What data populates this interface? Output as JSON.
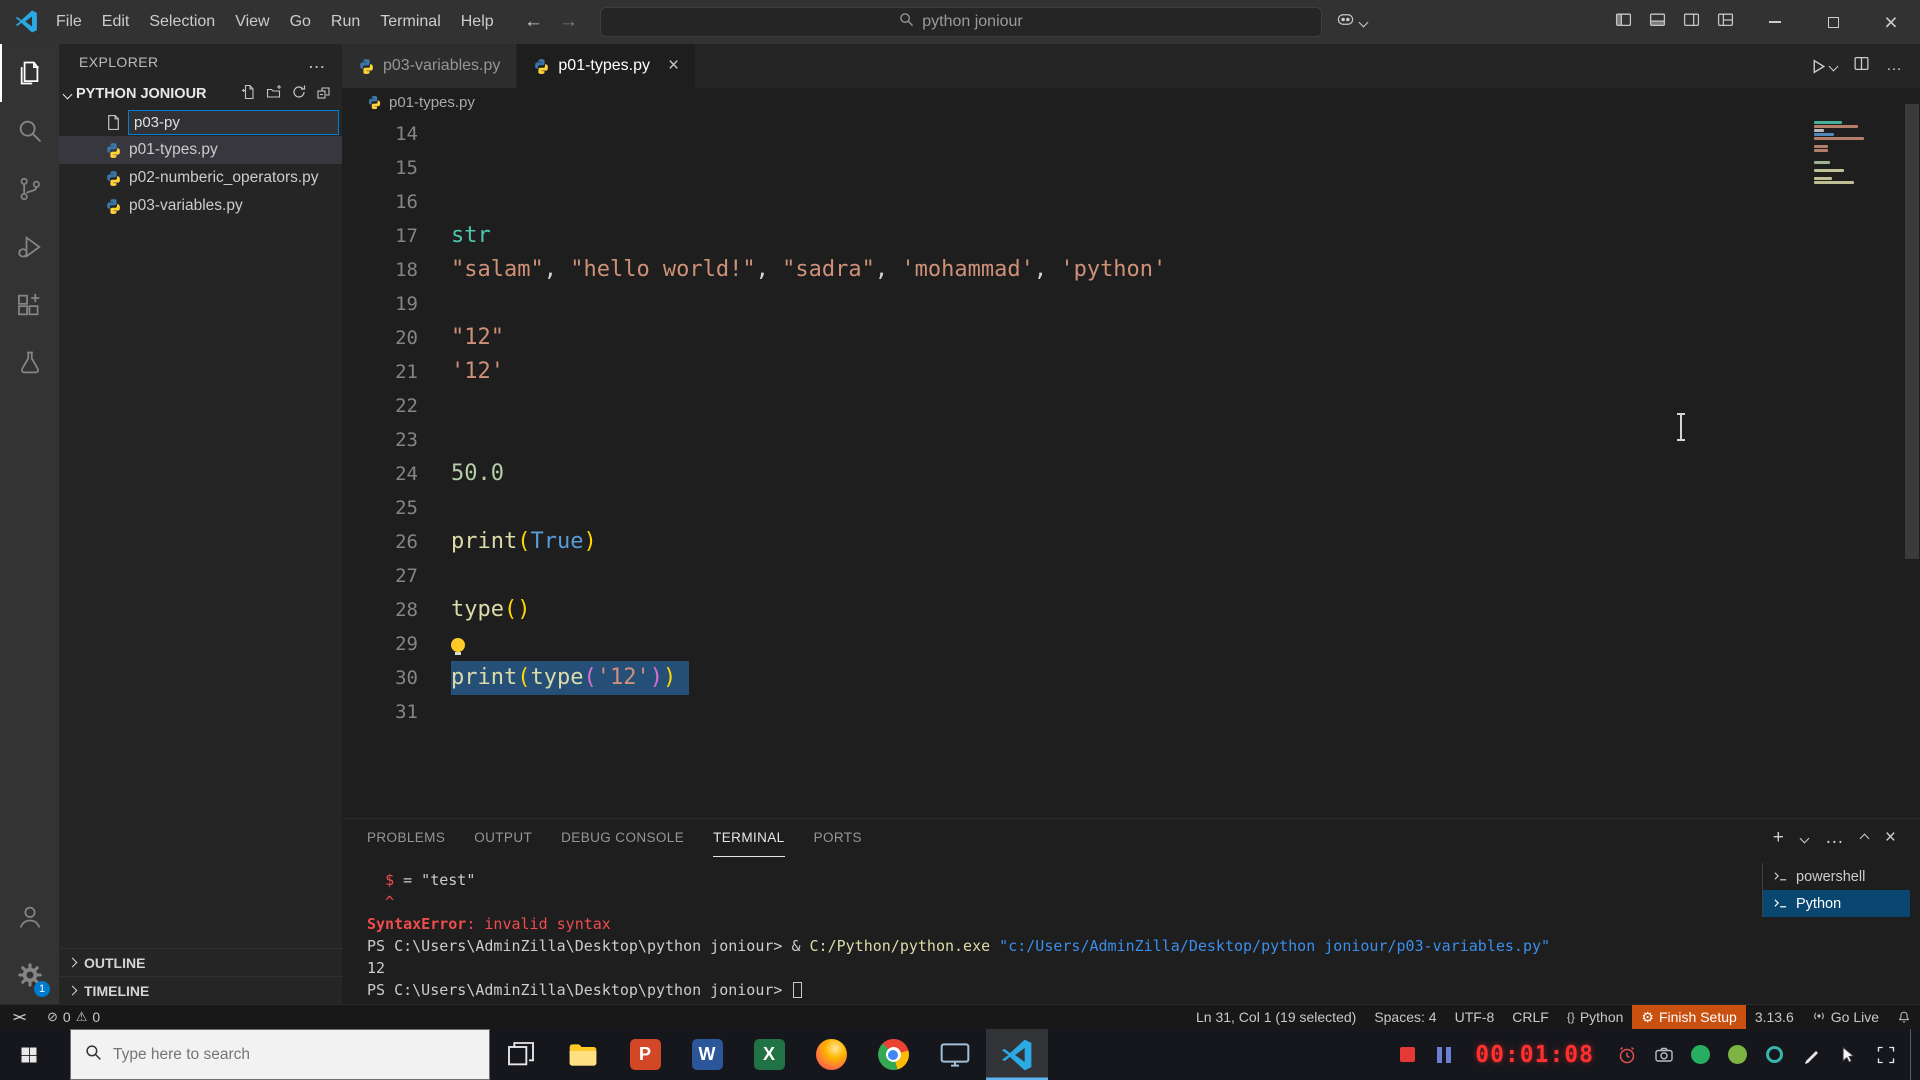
{
  "colors": {
    "accent": "#007acc",
    "selection": "#264f78",
    "error_red": "#f14c4c",
    "finish_setup_bg": "#ca5010",
    "timer_red": "#ff3030"
  },
  "icons": {
    "back": "←",
    "forward": "→",
    "more": "…",
    "close": "×",
    "add": "+",
    "gear": "⚙",
    "error_glyph": "⊘",
    "warning_glyph": "⚠",
    "remote_glyph": "><",
    "braces": "{}",
    "ppt_letter": "P",
    "word_letter": "W",
    "excel_letter": "X"
  },
  "window": {
    "menu": [
      "File",
      "Edit",
      "Selection",
      "View",
      "Go",
      "Run",
      "Terminal",
      "Help"
    ],
    "search": "python joniour"
  },
  "activity": {
    "settings_badge": "1"
  },
  "explorer": {
    "header": "EXPLORER",
    "folder": "PYTHON JONIOUR",
    "rename_value": "p03-py",
    "files": [
      {
        "name": "p01-types.py",
        "active": true
      },
      {
        "name": "p02-numberic_operators.py",
        "active": false
      },
      {
        "name": "p03-variables.py",
        "active": false
      }
    ],
    "sections": [
      "OUTLINE",
      "TIMELINE"
    ]
  },
  "tabs": [
    {
      "label": "p03-variables.py",
      "active": false
    },
    {
      "label": "p01-types.py",
      "active": true
    }
  ],
  "breadcrumb": "p01-types.py",
  "editor": {
    "lines": [
      {
        "n": 14,
        "tokens": []
      },
      {
        "n": 15,
        "tokens": []
      },
      {
        "n": 16,
        "tokens": []
      },
      {
        "n": 17,
        "tokens": [
          [
            "str",
            "cls"
          ]
        ]
      },
      {
        "n": 18,
        "tokens": [
          [
            "\"salam\"",
            "str"
          ],
          [
            ", ",
            "pl"
          ],
          [
            "\"hello world!\"",
            "str"
          ],
          [
            ", ",
            "pl"
          ],
          [
            "\"sadra\"",
            "str"
          ],
          [
            ", ",
            "pl"
          ],
          [
            "'mohammad'",
            "str"
          ],
          [
            ", ",
            "pl"
          ],
          [
            "'python'",
            "str"
          ]
        ]
      },
      {
        "n": 19,
        "tokens": []
      },
      {
        "n": 20,
        "tokens": [
          [
            "\"12\"",
            "str"
          ]
        ]
      },
      {
        "n": 21,
        "tokens": [
          [
            "'12'",
            "str"
          ]
        ]
      },
      {
        "n": 22,
        "tokens": []
      },
      {
        "n": 23,
        "tokens": []
      },
      {
        "n": 24,
        "tokens": [
          [
            "50.0",
            "num"
          ]
        ]
      },
      {
        "n": 25,
        "tokens": []
      },
      {
        "n": 26,
        "tokens": [
          [
            "print",
            "fn"
          ],
          [
            "(",
            "b1"
          ],
          [
            "True",
            "kw"
          ],
          [
            ")",
            "b1"
          ]
        ]
      },
      {
        "n": 27,
        "tokens": []
      },
      {
        "n": 28,
        "tokens": [
          [
            "type",
            "fn"
          ],
          [
            "(",
            "b1"
          ],
          [
            ")",
            "b1"
          ]
        ]
      },
      {
        "n": 29,
        "tokens": [],
        "lightbulb": true
      },
      {
        "n": 30,
        "selected": true,
        "tokens": [
          [
            "print",
            "fn"
          ],
          [
            "(",
            "b1"
          ],
          [
            "type",
            "fn"
          ],
          [
            "(",
            "b2"
          ],
          [
            "'12'",
            "str"
          ],
          [
            ")",
            "b2"
          ],
          [
            ")",
            "b1"
          ]
        ]
      },
      {
        "n": 31,
        "tokens": []
      }
    ]
  },
  "panel": {
    "tabs": [
      "PROBLEMS",
      "OUTPUT",
      "DEBUG CONSOLE",
      "TERMINAL",
      "PORTS"
    ],
    "active_tab": "TERMINAL",
    "terminal_lines": [
      {
        "tokens": [
          [
            "  ",
            "pl"
          ],
          [
            "$",
            "err"
          ],
          [
            " = \"test\"",
            "pl"
          ]
        ]
      },
      {
        "tokens": [
          [
            "  ^",
            "err"
          ]
        ]
      },
      {
        "tokens": [
          [
            "SyntaxError",
            "errb"
          ],
          [
            ": invalid syntax",
            "err"
          ]
        ]
      },
      {
        "tokens": [
          [
            "PS C:\\Users\\AdminZilla\\Desktop\\python joniour> ",
            "pl"
          ],
          [
            "& ",
            "pl"
          ],
          [
            "C:/Python/python.exe ",
            "cmd"
          ],
          [
            "\"c:/Users/AdminZilla/Desktop/python joniour/p03-variables.py\"",
            "path"
          ]
        ]
      },
      {
        "tokens": [
          [
            "12",
            "pl"
          ]
        ]
      },
      {
        "tokens": [
          [
            "PS C:\\Users\\AdminZilla\\Desktop\\python joniour> ",
            "pl"
          ]
        ],
        "cursor": true
      }
    ],
    "terminals": [
      {
        "name": "powershell",
        "active": false
      },
      {
        "name": "Python",
        "active": true
      }
    ]
  },
  "status": {
    "errors": "0",
    "warnings": "0",
    "cursor": "Ln 31, Col 1 (19 selected)",
    "indent": "Spaces: 4",
    "encoding": "UTF-8",
    "eol": "CRLF",
    "language": "Python",
    "setup": "Finish Setup",
    "version": "3.13.6",
    "golive": "Go Live"
  },
  "taskbar": {
    "search_placeholder": "Type here to search",
    "timer": "00:01:08"
  }
}
